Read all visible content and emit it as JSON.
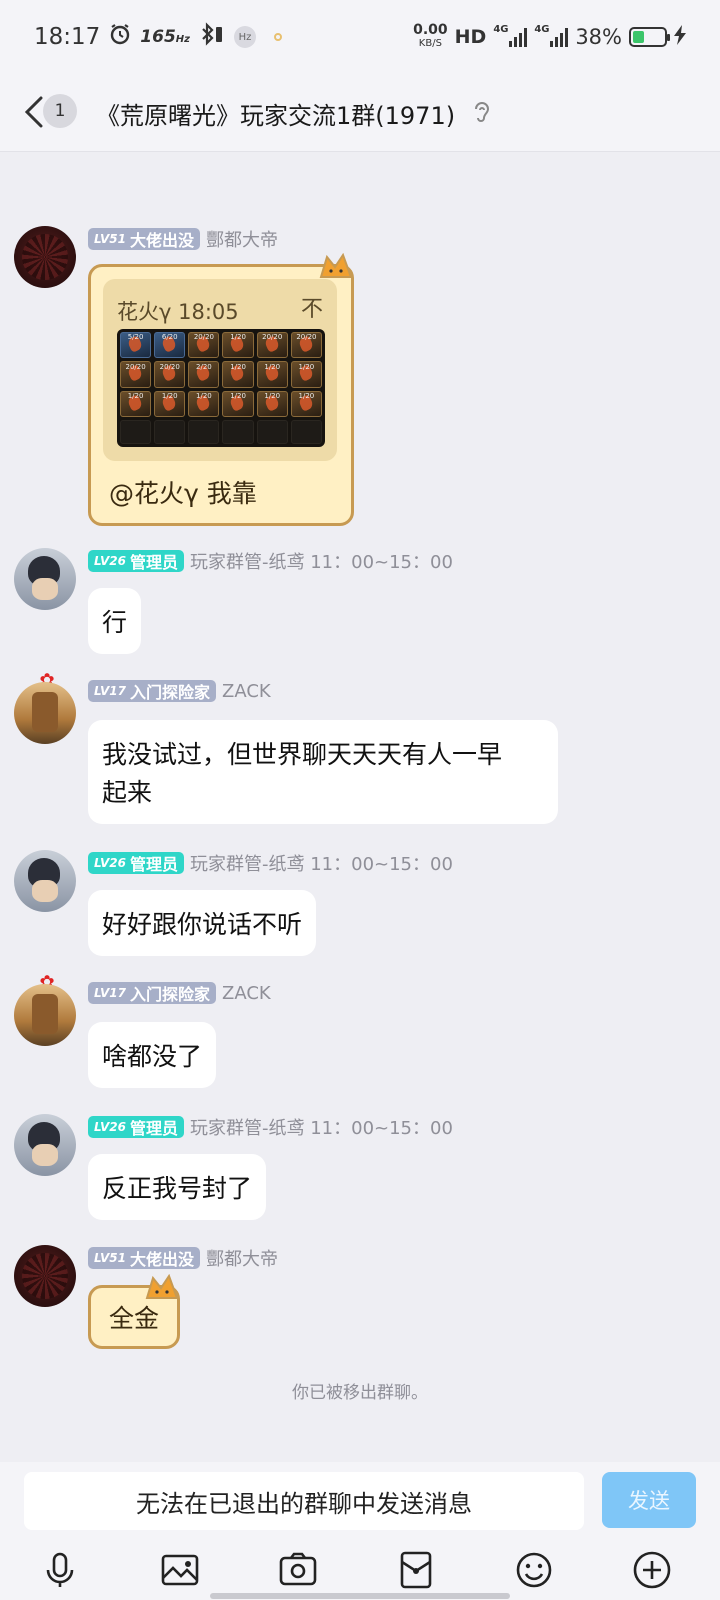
{
  "status_bar": {
    "time": "18:17",
    "refresh_rate": "165",
    "refresh_unit": "Hz",
    "chip": "Hz",
    "net_speed": "0.00",
    "net_unit": "KB/S",
    "hd": "HD",
    "signal1": "4G",
    "signal2": "4G",
    "battery_pct": "38%",
    "battery_level": 0.38
  },
  "header": {
    "unread_count": "1",
    "title": "《荒原曙光》玩家交流1群(1971)"
  },
  "messages": [
    {
      "level": "LV51",
      "title": "大佬出没",
      "nick": "酆都大帝",
      "quote": {
        "author_time": "花火γ 18:05",
        "pin_icon": "不"
      },
      "inventory": [
        "5/20",
        "6/20",
        "20/20",
        "1/20",
        "20/20",
        "20/20",
        "20/20",
        "20/20",
        "2/20",
        "1/20",
        "1/20",
        "1/20",
        "1/20",
        "1/20",
        "1/20",
        "1/20",
        "1/20",
        "1/20"
      ],
      "text": "@花火γ 我靠"
    },
    {
      "level": "LV26",
      "title": "管理员",
      "nick": "玩家群管-纸鸢 11：00~15：00",
      "text": "行"
    },
    {
      "level": "LV17",
      "title": "入门探险家",
      "nick": "ZACK",
      "text_line1": "我没试过，但世界聊天天天有人一早",
      "text_line2": "起来"
    },
    {
      "level": "LV26",
      "title": "管理员",
      "nick": "玩家群管-纸鸢 11：00~15：00",
      "text": "好好跟你说话不听"
    },
    {
      "level": "LV17",
      "title": "入门探险家",
      "nick": "ZACK",
      "text": "啥都没了"
    },
    {
      "level": "LV26",
      "title": "管理员",
      "nick": "玩家群管-纸鸢 11：00~15：00",
      "text": "反正我号封了"
    },
    {
      "level": "LV51",
      "title": "大佬出没",
      "nick": "酆都大帝",
      "text": "全金"
    }
  ],
  "system_tip": "你已被移出群聊。",
  "input": {
    "placeholder": "无法在已退出的群聊中发送消息",
    "send_label": "发送"
  },
  "colors": {
    "accent_send": "#7fc6f7",
    "badge_grey": "#a7afc8",
    "badge_teal": "#2fd6c8",
    "cat_bubble": "#fff0c4"
  },
  "icons": [
    "alarm-icon",
    "bluetooth-icon",
    "battery-icon",
    "charging-icon",
    "back-arrow-icon",
    "ear-icon",
    "microphone-icon",
    "image-icon",
    "camera-icon",
    "red-packet-icon",
    "emoji-icon",
    "plus-icon"
  ]
}
